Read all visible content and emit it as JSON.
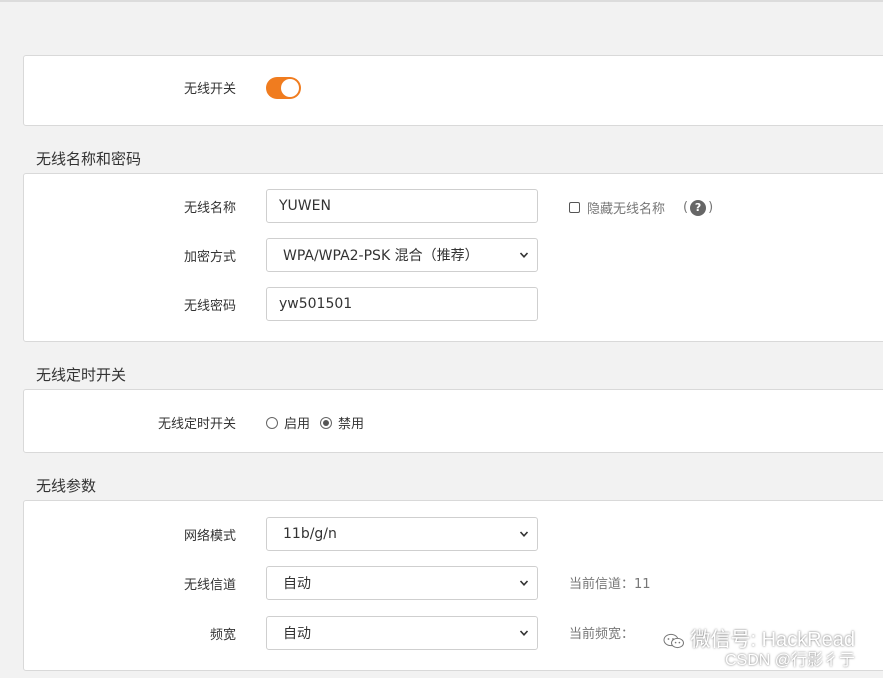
{
  "wireless_switch": {
    "label": "无线开关",
    "on": true,
    "accent_color": "#f07c1f"
  },
  "ssid_section": {
    "title": "无线名称和密码",
    "ssid_label": "无线名称",
    "ssid_value": "YUWEN",
    "hide_ssid_label": "隐藏无线名称",
    "help_paren_open": "(",
    "help_glyph": "?",
    "help_paren_close": ")",
    "encryption_label": "加密方式",
    "encryption_value": "WPA/WPA2-PSK 混合（推荐）",
    "password_label": "无线密码",
    "password_value": "yw501501"
  },
  "schedule_section": {
    "title": "无线定时开关",
    "label": "无线定时开关",
    "option_enable": "启用",
    "option_disable": "禁用",
    "selected": "禁用"
  },
  "params_section": {
    "title": "无线参数",
    "mode_label": "网络模式",
    "mode_value": "11b/g/n",
    "channel_label": "无线信道",
    "channel_value": "自动",
    "current_channel_text": "当前信道：11",
    "bandwidth_label": "频宽",
    "bandwidth_value": "自动",
    "current_bandwidth_text": "当前频宽："
  },
  "watermark": {
    "line1": "微信号: HackRead",
    "line2": "CSDN @行影彳亍"
  }
}
